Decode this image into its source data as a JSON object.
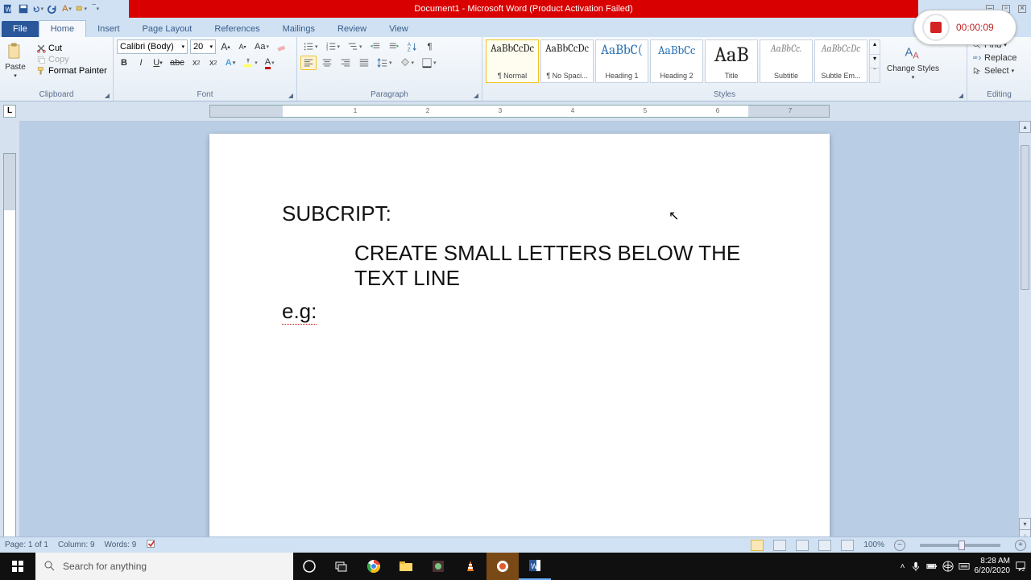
{
  "title": "Document1 - Microsoft Word (Product Activation Failed)",
  "tabs": {
    "file": "File",
    "home": "Home",
    "insert": "Insert",
    "pagelayout": "Page Layout",
    "references": "References",
    "mailings": "Mailings",
    "review": "Review",
    "view": "View"
  },
  "clipboard": {
    "label": "Clipboard",
    "cut": "Cut",
    "copy": "Copy",
    "fmt": "Format Painter",
    "paste": "Paste"
  },
  "font": {
    "label": "Font",
    "name": "Calibri (Body)",
    "size": "20"
  },
  "paragraph": {
    "label": "Paragraph"
  },
  "styles": {
    "label": "Styles",
    "items": [
      {
        "preview": "AaBbCcDc",
        "name": "¶ Normal",
        "sel": true,
        "ps": "13"
      },
      {
        "preview": "AaBbCcDc",
        "name": "¶ No Spaci...",
        "ps": "13"
      },
      {
        "preview": "AaBbC(",
        "name": "Heading 1",
        "ps": "17",
        "color": "#2e74b5"
      },
      {
        "preview": "AaBbCc",
        "name": "Heading 2",
        "ps": "15",
        "color": "#2e74b5"
      },
      {
        "preview": "AaB",
        "name": "Title",
        "ps": "26"
      },
      {
        "preview": "AaBbCc.",
        "name": "Subtitle",
        "ps": "12",
        "italic": true,
        "color": "#888"
      },
      {
        "preview": "AaBbCcDc",
        "name": "Subtle Em...",
        "ps": "12",
        "italic": true,
        "color": "#888"
      }
    ],
    "change": "Change Styles"
  },
  "editing": {
    "label": "Editing",
    "find": "Find",
    "replace": "Replace",
    "select": "Select"
  },
  "doc": {
    "line1": "SUBCRIPT:",
    "line2": "CREATE SMALL LETTERS BELOW THE TEXT LINE",
    "line3": "e.g:"
  },
  "status": {
    "page": "Page: 1 of 1",
    "col": "Column: 9",
    "words": "Words: 9",
    "zoom": "100%"
  },
  "recorder": {
    "time": "00:00:09"
  },
  "taskbar": {
    "search": "Search for anything",
    "time": "8:28 AM",
    "date": "6/20/2020"
  },
  "ruler": {
    "marks": [
      "1",
      "2",
      "3",
      "4",
      "5",
      "6",
      "7"
    ]
  }
}
